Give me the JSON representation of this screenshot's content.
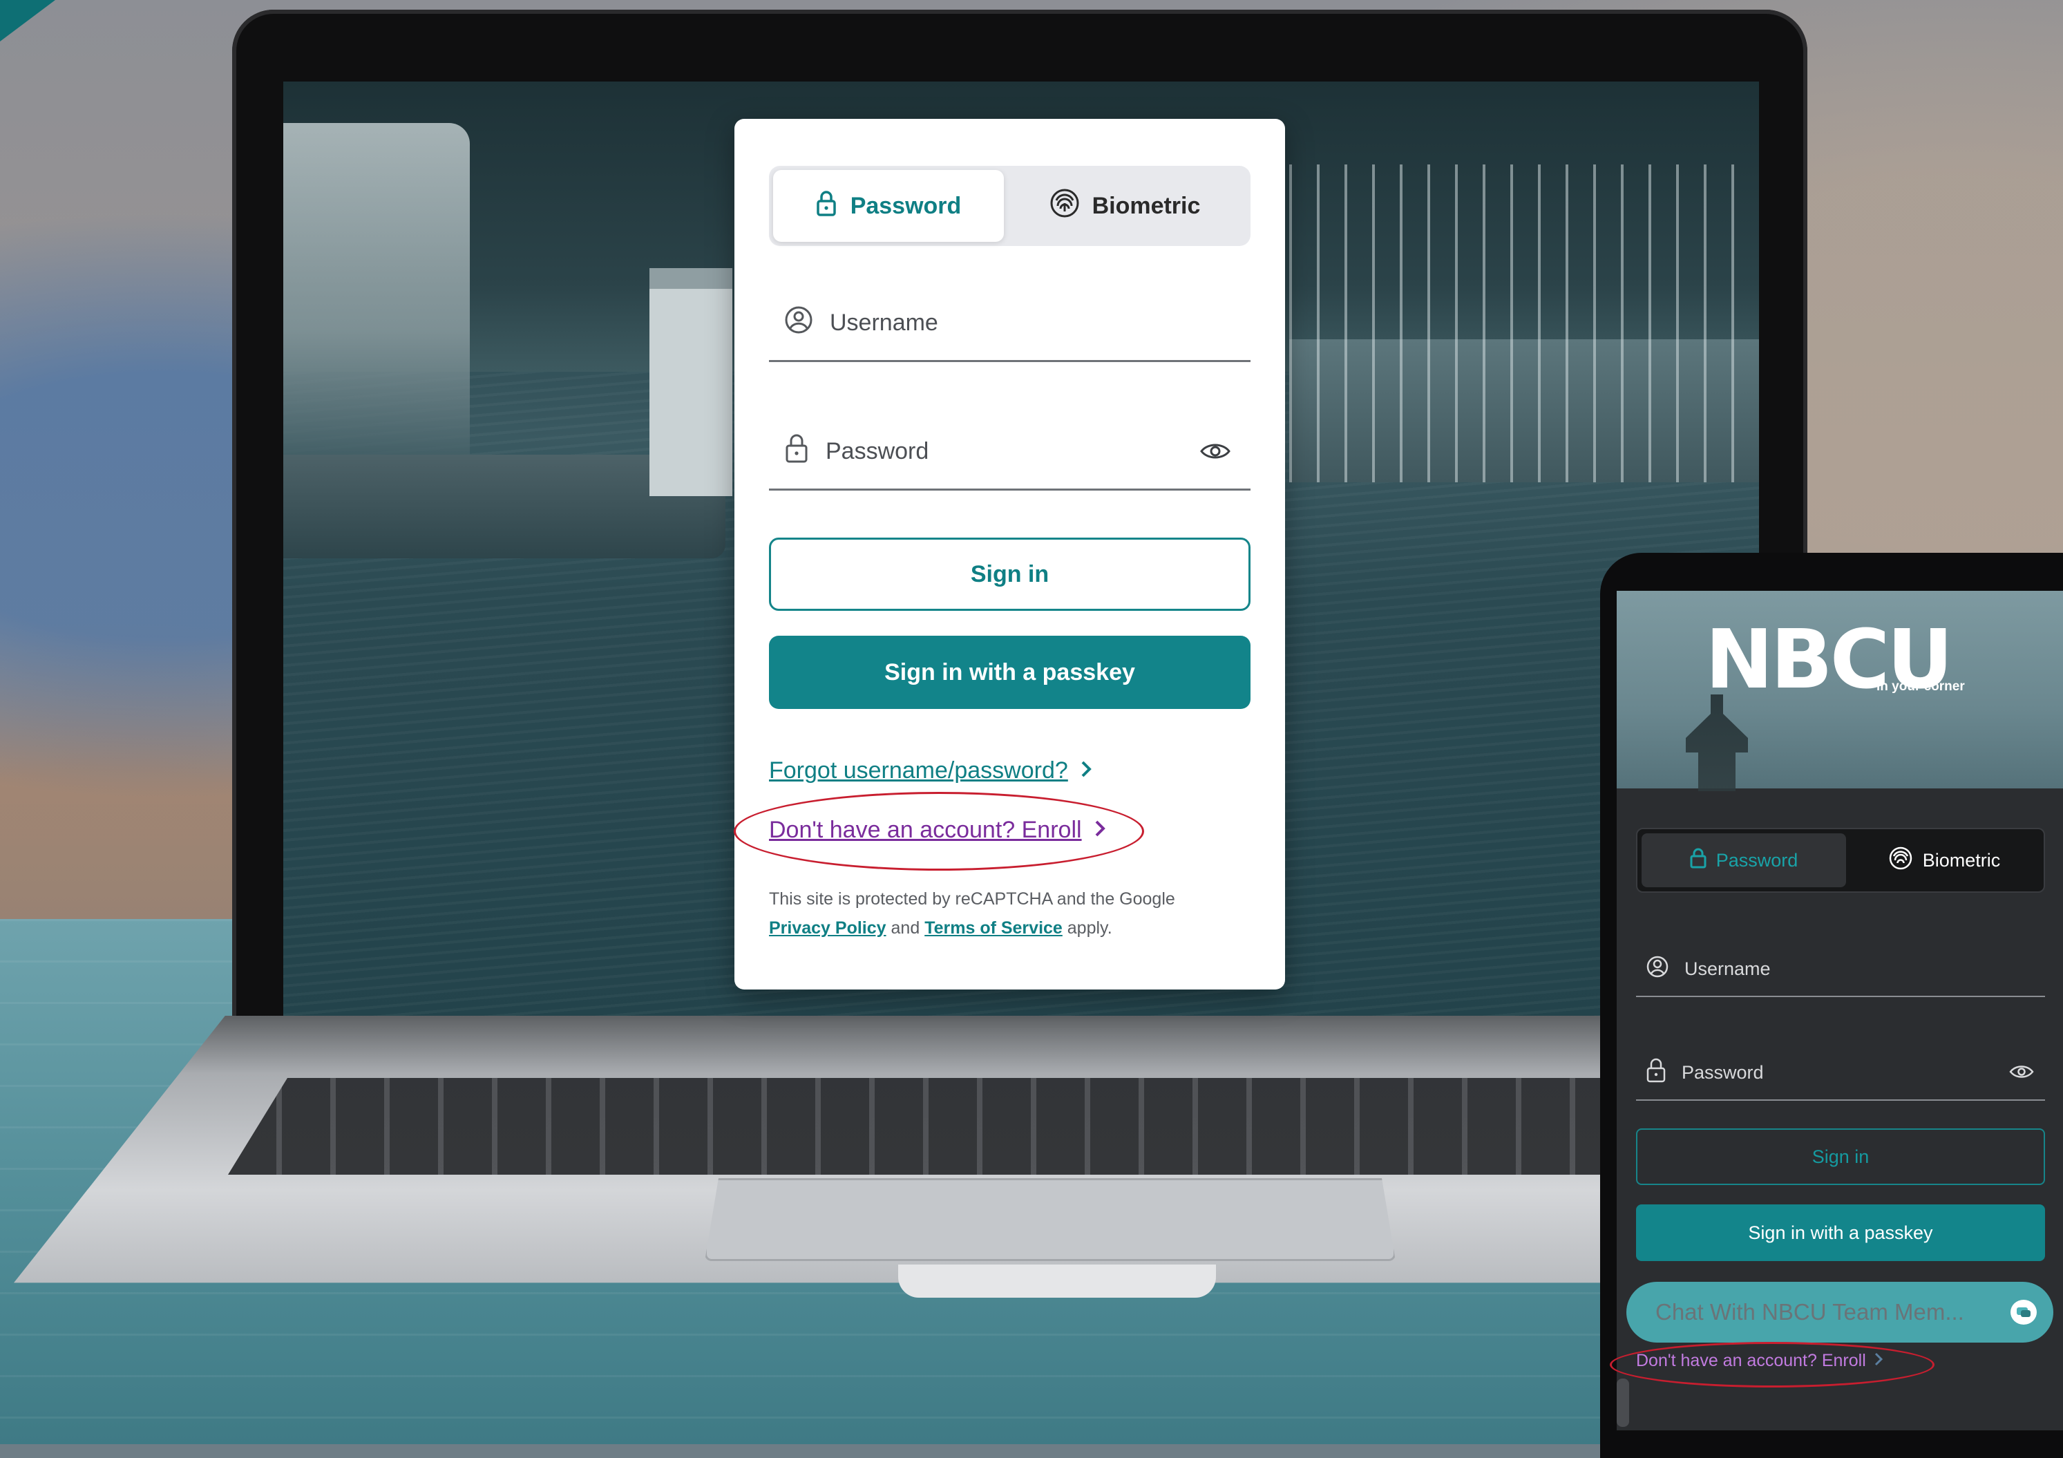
{
  "colors": {
    "accent": "#12848a",
    "link": "#0f7f84",
    "enroll_link": "#7a2c9c",
    "highlight_ellipse": "#c81e2f"
  },
  "desktop_login": {
    "tabs": [
      {
        "label": "Password",
        "icon": "lock-icon",
        "active": true
      },
      {
        "label": "Biometric",
        "icon": "fingerprint-icon",
        "active": false
      }
    ],
    "username": {
      "placeholder": "Username",
      "value": ""
    },
    "password": {
      "placeholder": "Password",
      "value": ""
    },
    "sign_in_label": "Sign in",
    "passkey_label": "Sign in with a passkey",
    "forgot_label": "Forgot username/password?",
    "enroll_label": "Don't have an account? Enroll",
    "recaptcha": {
      "text_1": "This site is protected by reCAPTCHA and the Google",
      "privacy_label": "Privacy Policy",
      "and_text": "and",
      "terms_label": "Terms of Service",
      "apply_text": "apply."
    }
  },
  "mobile_login": {
    "brand": "NBCU",
    "tagline": "In your corner",
    "tabs": [
      {
        "label": "Password",
        "icon": "lock-icon",
        "active": true
      },
      {
        "label": "Biometric",
        "icon": "fingerprint-icon",
        "active": false
      }
    ],
    "username": {
      "placeholder": "Username",
      "value": ""
    },
    "password": {
      "placeholder": "Password",
      "value": ""
    },
    "sign_in_label": "Sign in",
    "passkey_label": "Sign in with a passkey",
    "chat_label": "Chat With NBCU Team Mem...",
    "enroll_label": "Don't have an account? Enroll"
  }
}
